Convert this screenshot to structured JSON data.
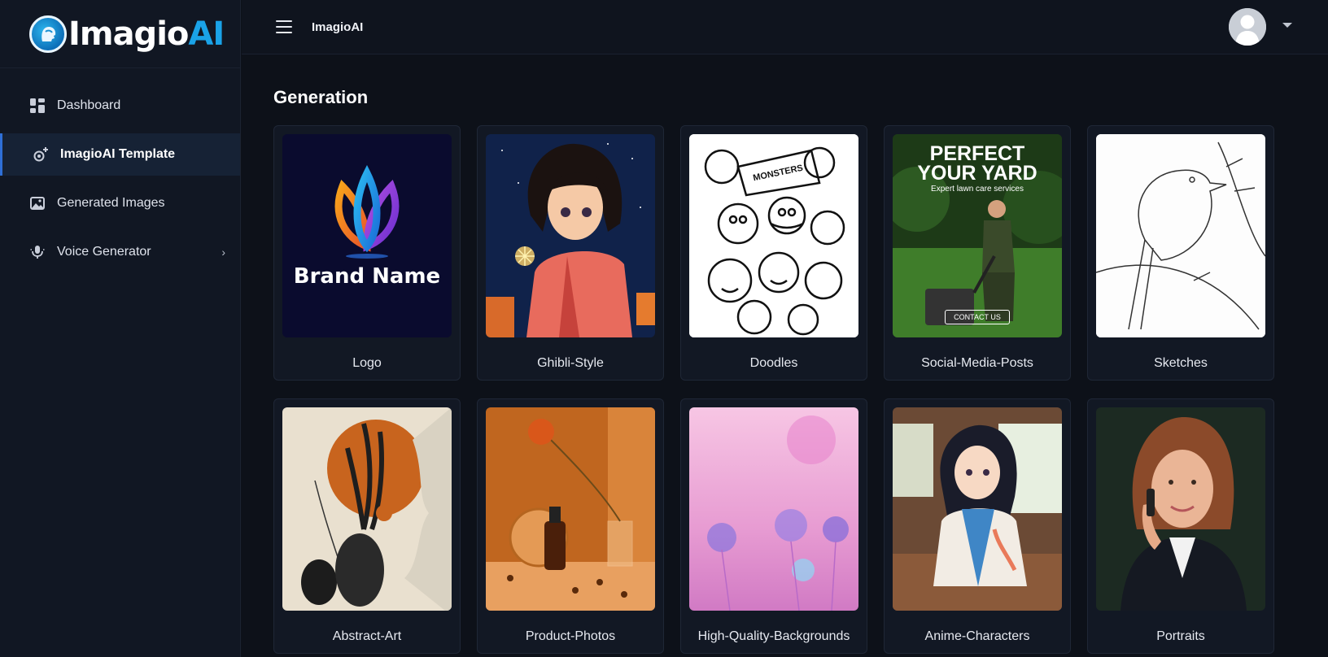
{
  "brand": {
    "name_main": "Imagio",
    "name_accent": "AI"
  },
  "sidebar": {
    "items": [
      {
        "label": "Dashboard",
        "icon": "dashboard-icon"
      },
      {
        "label": "ImagioAI Template",
        "icon": "template-icon"
      },
      {
        "label": "Generated Images",
        "icon": "image-icon"
      },
      {
        "label": "Voice Generator",
        "icon": "microphone-icon"
      }
    ]
  },
  "topbar": {
    "title": "ImagioAI"
  },
  "main": {
    "section_title": "Generation",
    "cards": [
      {
        "label": "Logo",
        "thumb_text": "Brand Name"
      },
      {
        "label": "Ghibli-Style"
      },
      {
        "label": "Doodles",
        "thumb_text": "MONSTERS"
      },
      {
        "label": "Social-Media-Posts",
        "thumb_title_1": "PERFECT",
        "thumb_title_2": "YOUR YARD",
        "thumb_subtitle": "Expert lawn care services",
        "thumb_button": "CONTACT US"
      },
      {
        "label": "Sketches"
      },
      {
        "label": "Abstract-Art"
      },
      {
        "label": "Product-Photos"
      },
      {
        "label": "High-Quality-Backgrounds"
      },
      {
        "label": "Anime-Characters"
      },
      {
        "label": "Portraits"
      }
    ]
  },
  "colors": {
    "accent": "#1aa3e8",
    "active_nav": "#2f6fd6",
    "background": "#0d1119"
  }
}
